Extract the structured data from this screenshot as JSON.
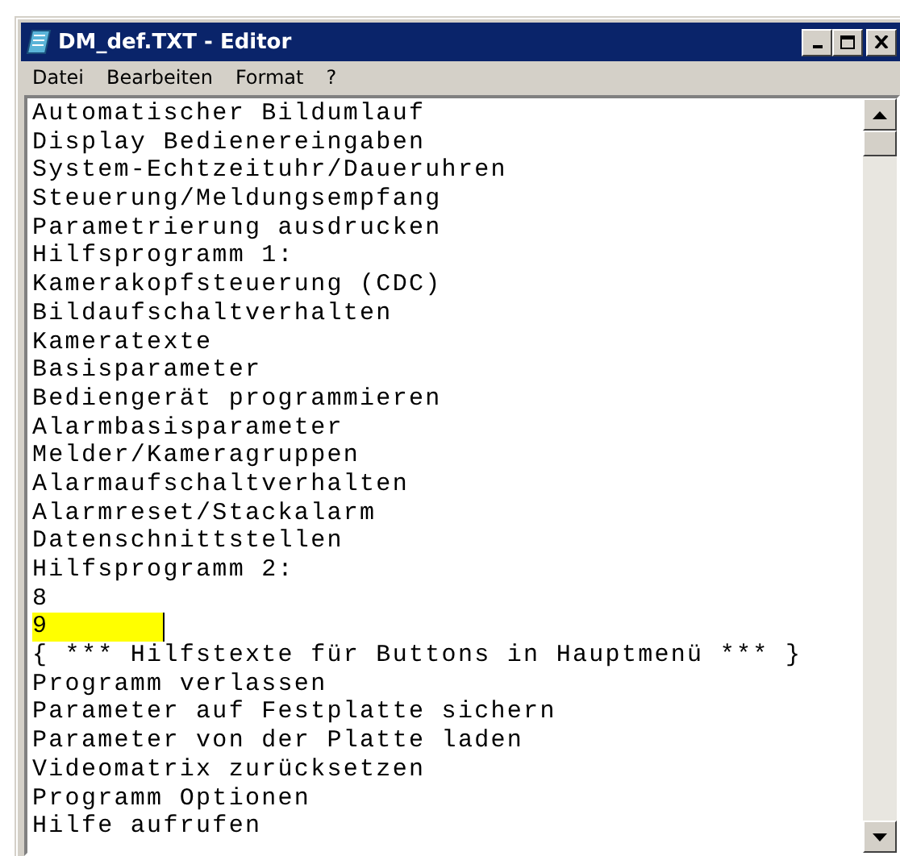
{
  "window": {
    "title": "DM_def.TXT - Editor"
  },
  "menu": [
    "Datei",
    "Bearbeiten",
    "Format",
    "?"
  ],
  "lines": [
    {
      "text": "Automatischer Bildumlauf",
      "highlighted": false,
      "cursor": false
    },
    {
      "text": "Display Bedienereingaben",
      "highlighted": false,
      "cursor": false
    },
    {
      "text": "System-Echtzeituhr/Daueruhren",
      "highlighted": false,
      "cursor": false
    },
    {
      "text": "Steuerung/Meldungsempfang",
      "highlighted": false,
      "cursor": false
    },
    {
      "text": "Parametrierung ausdrucken",
      "highlighted": false,
      "cursor": false
    },
    {
      "text": "Hilfsprogramm 1:",
      "highlighted": false,
      "cursor": false
    },
    {
      "text": "Kamerakopfsteuerung (CDC)",
      "highlighted": false,
      "cursor": false
    },
    {
      "text": "Bildaufschaltverhalten",
      "highlighted": false,
      "cursor": false
    },
    {
      "text": "Kameratexte",
      "highlighted": false,
      "cursor": false
    },
    {
      "text": "Basisparameter",
      "highlighted": false,
      "cursor": false
    },
    {
      "text": "Bediengerät programmieren",
      "highlighted": false,
      "cursor": false
    },
    {
      "text": "Alarmbasisparameter",
      "highlighted": false,
      "cursor": false
    },
    {
      "text": "Melder/Kameragruppen",
      "highlighted": false,
      "cursor": false
    },
    {
      "text": "Alarmaufschaltverhalten",
      "highlighted": false,
      "cursor": false
    },
    {
      "text": "Alarmreset/Stackalarm",
      "highlighted": false,
      "cursor": false
    },
    {
      "text": "Datenschnittstellen",
      "highlighted": false,
      "cursor": false
    },
    {
      "text": "Hilfsprogramm 2:",
      "highlighted": false,
      "cursor": false
    },
    {
      "text": "8",
      "highlighted": false,
      "cursor": false
    },
    {
      "text": "9",
      "highlighted": true,
      "cursor": true
    },
    {
      "text": "{ *** Hilfstexte für Buttons in Hauptmenü *** }",
      "highlighted": false,
      "cursor": false
    },
    {
      "text": "Programm verlassen",
      "highlighted": false,
      "cursor": false
    },
    {
      "text": "Parameter auf Festplatte sichern",
      "highlighted": false,
      "cursor": false
    },
    {
      "text": "Parameter von der Platte laden",
      "highlighted": false,
      "cursor": false
    },
    {
      "text": "Videomatrix zurücksetzen",
      "highlighted": false,
      "cursor": false
    },
    {
      "text": "Programm Optionen",
      "highlighted": false,
      "cursor": false
    },
    {
      "text": "Hilfe aufrufen",
      "highlighted": false,
      "cursor": false
    }
  ]
}
